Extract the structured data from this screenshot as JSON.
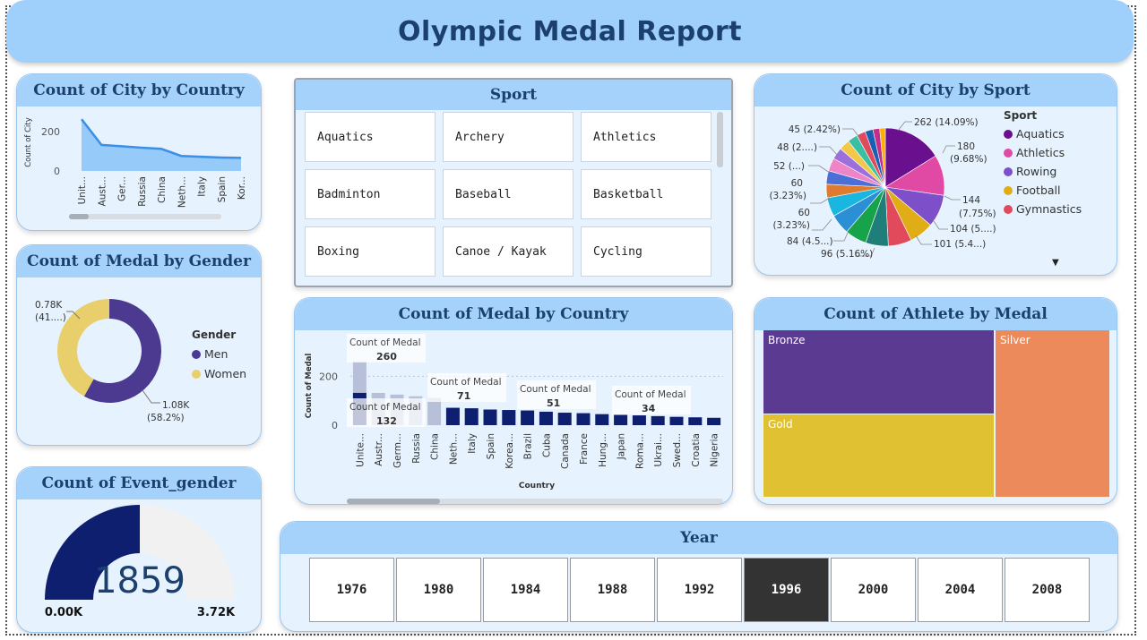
{
  "report_title": "Olympic Medal Report",
  "colors": {
    "accent": "#a4d2fb",
    "navy": "#0d1f6e",
    "light_bar": "#b8bfd9",
    "area": "#87c3f7",
    "line": "#3a8fe6"
  },
  "cards": {
    "city_by_country": {
      "title": "Count of City by Country"
    },
    "medal_by_gender": {
      "title": "Count of Medal by Gender",
      "legend_title": "Gender"
    },
    "event_gender": {
      "title": "Count of Event_gender"
    },
    "sport_slicer": {
      "title": "Sport"
    },
    "medal_by_country": {
      "title": "Count of Medal by Country"
    },
    "city_by_sport": {
      "title": "Count of City by Sport",
      "legend_title": "Sport"
    },
    "athlete_by_medal": {
      "title": "Count of Athlete by Medal"
    },
    "year_slicer": {
      "title": "Year"
    }
  },
  "sport_slicer": {
    "items": [
      "Aquatics",
      "Archery",
      "Athletics",
      "Badminton",
      "Baseball",
      "Basketball",
      "Boxing",
      "Canoe / Kayak",
      "Cycling"
    ]
  },
  "year_slicer": {
    "items": [
      "1976",
      "1980",
      "1984",
      "1988",
      "1992",
      "1996",
      "2000",
      "2004",
      "2008"
    ],
    "selected": "1996"
  },
  "chart_data": [
    {
      "id": "city_by_country",
      "type": "area",
      "ylabel": "Count of City",
      "categories": [
        "Unit...",
        "Aust...",
        "Ger...",
        "Russia",
        "China",
        "Neth...",
        "Italy",
        "Spain",
        "Kor..."
      ],
      "values": [
        262,
        132,
        125,
        118,
        112,
        76,
        72,
        68,
        66
      ],
      "ylim": [
        0,
        290
      ],
      "yticks": [
        0,
        200
      ]
    },
    {
      "id": "medal_by_gender",
      "type": "pie",
      "donut": true,
      "series": [
        {
          "name": "Men",
          "value": 1.08,
          "label": "1.08K",
          "pct": "(58.2%)",
          "color": "#4b3a8f"
        },
        {
          "name": "Women",
          "value": 0.78,
          "label": "0.78K",
          "pct": "(41....)",
          "color": "#e8cf6b"
        }
      ]
    },
    {
      "id": "event_gender",
      "type": "gauge",
      "value": 1859,
      "value_label": "1859",
      "min": 0,
      "max": 3718,
      "min_label": "0.00K",
      "max_label": "3.72K"
    },
    {
      "id": "medal_by_country",
      "type": "bar",
      "xlabel": "Country",
      "ylabel": "Count of Medal",
      "ylim": [
        0,
        300
      ],
      "yticks": [
        0,
        200
      ],
      "categories": [
        "Unite...",
        "Austr...",
        "Germ...",
        "Russia",
        "China",
        "Neth...",
        "Italy",
        "Spain",
        "Korea...",
        "Brazil",
        "Cuba",
        "Canada",
        "France",
        "Hung...",
        "Japan",
        "Roma...",
        "Ukrai...",
        "Swed...",
        "Croatia",
        "Nigeria"
      ],
      "values": [
        260,
        132,
        125,
        118,
        112,
        71,
        69,
        64,
        62,
        60,
        55,
        51,
        49,
        45,
        42,
        40,
        37,
        34,
        32,
        30
      ],
      "highlight_values": [
        132,
        0,
        0,
        0,
        0,
        71,
        69,
        64,
        62,
        60,
        55,
        51,
        49,
        45,
        42,
        40,
        37,
        34,
        32,
        30
      ],
      "tooltips": [
        {
          "label": "Count of Medal",
          "value": "260"
        },
        {
          "label": "Count of Medal",
          "value": "132"
        },
        {
          "label": "Count of Medal",
          "value": "71"
        },
        {
          "label": "Count of Medal",
          "value": "51"
        },
        {
          "label": "Count of Medal",
          "value": "34"
        }
      ]
    },
    {
      "id": "city_by_sport",
      "type": "pie",
      "legend": [
        "Aquatics",
        "Athletics",
        "Rowing",
        "Football",
        "Gymnastics"
      ],
      "legend_colors": [
        "#6a0f8e",
        "#e04aa5",
        "#7d50c9",
        "#e0ad17",
        "#e04a5a"
      ],
      "slices": [
        {
          "value": 262,
          "color": "#6a0f8e"
        },
        {
          "value": 180,
          "color": "#e04aa5"
        },
        {
          "value": 144,
          "color": "#7d50c9"
        },
        {
          "value": 108,
          "color": "#e0ad17"
        },
        {
          "value": 104,
          "color": "#e04a5a"
        },
        {
          "value": 101,
          "color": "#1e7f7a"
        },
        {
          "value": 96,
          "color": "#17a34a"
        },
        {
          "value": 90,
          "color": "#2b8fd6"
        },
        {
          "value": 84,
          "color": "#19b6e0"
        },
        {
          "value": 60,
          "color": "#e07a2e"
        },
        {
          "value": 60,
          "color": "#4a6fd6"
        },
        {
          "value": 58,
          "color": "#ef84c8"
        },
        {
          "value": 52,
          "color": "#9b6fdc"
        },
        {
          "value": 48,
          "color": "#f2c84b"
        },
        {
          "value": 45,
          "color": "#3bbfa3"
        },
        {
          "value": 40,
          "color": "#e04a5a"
        },
        {
          "value": 35,
          "color": "#1a5fb4"
        },
        {
          "value": 30,
          "color": "#c22f8a"
        },
        {
          "value": 25,
          "color": "#ffb000"
        }
      ],
      "labels": [
        "262 (14.09%)",
        "180",
        "(9.68%)",
        "144",
        "(7.75%)",
        "104 (5....)",
        "101 (5.4...)",
        "96 (5.16%)",
        "84 (4.5...)",
        "60",
        "(3.23%)",
        "60",
        "(3.23%)",
        "52 (...)",
        "48 (2....)",
        "45 (2.42%)"
      ]
    },
    {
      "id": "athlete_by_medal",
      "type": "treemap",
      "items": [
        {
          "name": "Bronze",
          "color": "#5b3a92"
        },
        {
          "name": "Gold",
          "color": "#e0c132"
        },
        {
          "name": "Silver",
          "color": "#ec8a5c"
        }
      ]
    }
  ]
}
